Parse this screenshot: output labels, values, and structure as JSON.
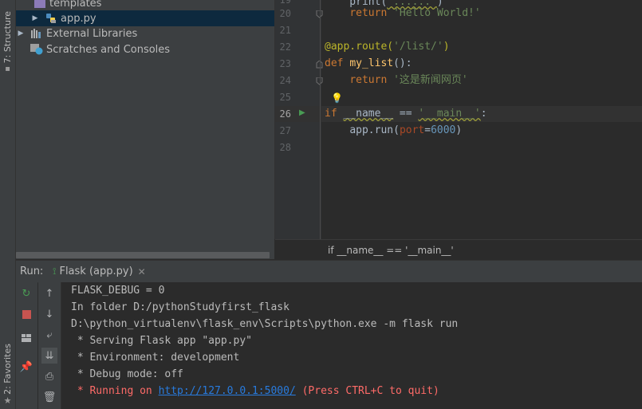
{
  "left_strip": {
    "structure_label": "7: Structure",
    "favorites_label": "2: Favorites"
  },
  "project_tree": {
    "items": [
      {
        "label": "templates",
        "icon": "folder-icon"
      },
      {
        "label": "app.py",
        "icon": "python-file-icon",
        "selected": true
      },
      {
        "label": "External Libraries",
        "icon": "libraries-icon"
      },
      {
        "label": "Scratches and Consoles",
        "icon": "scratches-icon"
      }
    ]
  },
  "editor": {
    "line_numbers": [
      "20",
      "21",
      "22",
      "23",
      "24",
      "25",
      "26",
      "27",
      "28"
    ],
    "current_line": "26",
    "partial_top_line": "print('...')",
    "lines": {
      "l20_kw": "return ",
      "l20_str": "'Hello World!'",
      "l22_deco": "@app.route(",
      "l22_str": "'/list/'",
      "l22_close": ")",
      "l23_kw": "def ",
      "l23_fn": "my_list",
      "l23_rest": "():",
      "l24_kw": "return ",
      "l24_str": "'这是新闻网页'",
      "l26_kw": "if ",
      "l26_name": "__name__",
      "l26_op": " == ",
      "l26_str": "'__main__'",
      "l26_colon": ":",
      "l27_call": "app.run(",
      "l27_param": "port",
      "l27_eq": "=",
      "l27_num": "6000",
      "l27_close": ")"
    },
    "breadcrumb": "if __name__ == '__main__'"
  },
  "run": {
    "label": "Run:",
    "tab_label": "Flask (app.py)",
    "console_lines": [
      "FLASK_DEBUG = 0",
      "In folder D:/pythonStudyfirst_flask",
      "D:\\python_virtualenv\\flask_env\\Scripts\\python.exe -m flask run",
      " * Serving Flask app \"app.py\"",
      " * Environment: development",
      " * Debug mode: off"
    ],
    "running_prefix": " * Running on ",
    "running_url": "http://127.0.0.1:5000/",
    "running_suffix": " (Press CTRL+C to quit)"
  },
  "colors": {
    "background": "#2b2b2b",
    "panel": "#3c3f41",
    "keyword": "#cc7832",
    "string": "#6a8759",
    "error": "#ff6b68",
    "link": "#287bde"
  }
}
